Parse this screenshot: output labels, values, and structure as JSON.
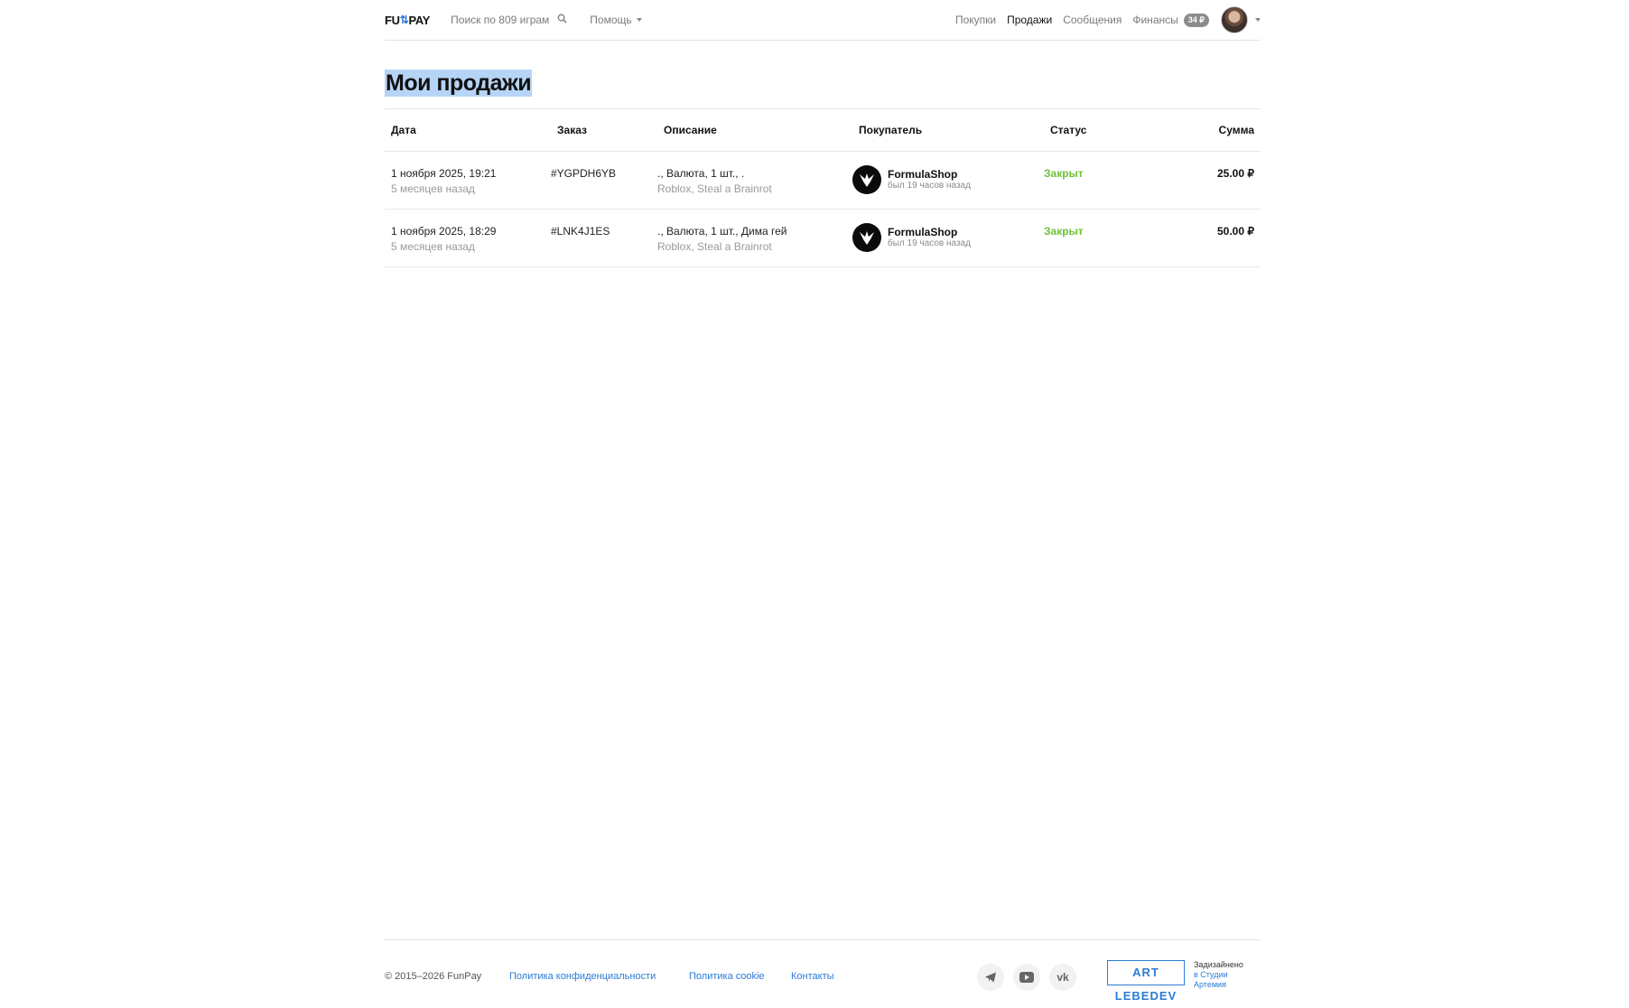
{
  "header": {
    "logo_left": "FU",
    "logo_right": "PAY",
    "search_label": "Поиск по 809 играм",
    "help_label": "Помощь",
    "nav": [
      {
        "label": "Покупки",
        "active": false
      },
      {
        "label": "Продажи",
        "active": true
      },
      {
        "label": "Сообщения",
        "active": false
      },
      {
        "label": "Финансы",
        "active": false
      }
    ],
    "balance_badge": "34 ₽"
  },
  "page": {
    "title": "Мои продажи"
  },
  "table": {
    "columns": [
      "Дата",
      "Заказ",
      "Описание",
      "Покупатель",
      "Статус",
      "Сумма"
    ],
    "rows": [
      {
        "date": "1 ноября 2025, 19:21",
        "ago": "5 месяцев назад",
        "order": "#YGPDH6YB",
        "desc": "., Валюта, 1 шт., .",
        "game": "Roblox, Steal a Brainrot",
        "buyer": "FormulaShop",
        "buyer_seen": "был 19 часов назад",
        "status": "Закрыт",
        "sum": "25.00 ₽"
      },
      {
        "date": "1 ноября 2025, 18:29",
        "ago": "5 месяцев назад",
        "order": "#LNK4J1ES",
        "desc": "., Валюта, 1 шт., Дима гей",
        "game": "Roblox, Steal a Brainrot",
        "buyer": "FormulaShop",
        "buyer_seen": "был 19 часов назад",
        "status": "Закрыт",
        "sum": "50.00 ₽"
      }
    ]
  },
  "footer": {
    "copyright": "© 2015–2026 FunPay",
    "links": [
      "Политика конфиденциальности",
      "Политика cookie",
      "Контакты"
    ],
    "art_logo": "ART LEBEDEV",
    "designed": "Задизайнено",
    "designed_by": "в Студии Артемия"
  },
  "colors": {
    "accent": "#2b7bd6",
    "status_closed": "#6cc43a",
    "title_highlight": "#b6d4f5"
  }
}
